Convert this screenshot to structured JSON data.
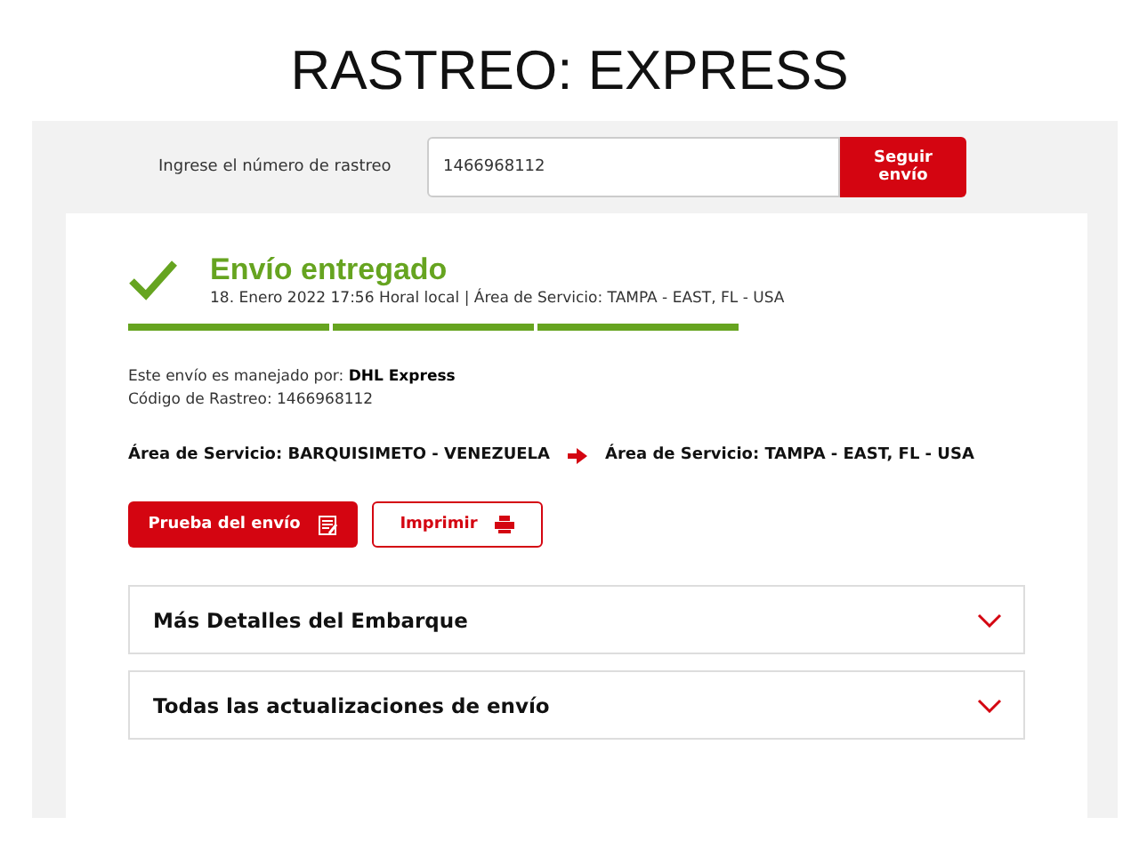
{
  "page_title": "RASTREO: EXPRESS",
  "search": {
    "label": "Ingrese el número de rastreo",
    "value": "1466968112",
    "button": "Seguir envío"
  },
  "status": {
    "title": "Envío entregado",
    "detail": "18. Enero 2022 17:56 Horal local | Área de Servicio: TAMPA - EAST, FL - USA",
    "segments": [
      {
        "filled": true
      },
      {
        "filled": true
      },
      {
        "filled": true
      }
    ]
  },
  "info": [
    "Este envío es manejado por: **DHL Express**",
    "Código de Rastreo: 1466968112"
  ],
  "route": {
    "origin": "Área de Servicio: BARQUISIMETO - VENEZUELA",
    "destination": "Área de Servicio: TAMPA - EAST, FL - USA"
  },
  "actions": [
    {
      "label": "Prueba del envío",
      "kind": "primary"
    },
    {
      "label": "Imprimir",
      "kind": "outline"
    }
  ],
  "sections": [
    {
      "title": "Más Detalles del Embarque",
      "expanded": false
    },
    {
      "title": "Todas las actualizaciones de envío",
      "expanded": false
    }
  ]
}
